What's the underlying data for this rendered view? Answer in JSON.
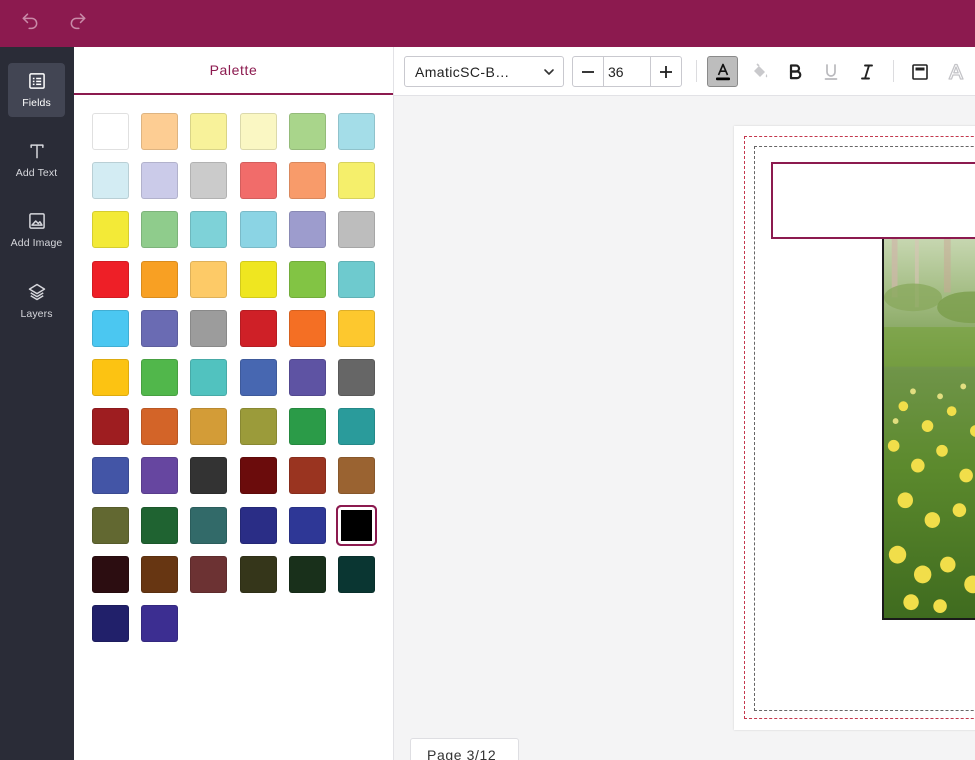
{
  "topbar": {
    "undo_icon": "undo-icon",
    "redo_icon": "redo-icon",
    "background": "#8c1a4f"
  },
  "rail": {
    "items": [
      {
        "label": "Fields",
        "icon": "list-icon",
        "active": true
      },
      {
        "label": "Add Text",
        "icon": "text-t-icon",
        "active": false
      },
      {
        "label": "Add Image",
        "icon": "image-icon",
        "active": false
      },
      {
        "label": "Layers",
        "icon": "layers-icon",
        "active": false
      }
    ]
  },
  "panel": {
    "tab_label": "Palette",
    "swatches": [
      "#ffffff",
      "#fdcd93",
      "#f8f29a",
      "#faf7c3",
      "#a9d58b",
      "#a4dde8",
      "#d3ecf3",
      "#cbcbe9",
      "#cbcbcb",
      "#f16c6a",
      "#f89b6a",
      "#f5ef6b",
      "#f3ea37",
      "#8fcc8c",
      "#7ed2d8",
      "#8bd4e4",
      "#9d9ccd",
      "#bdbdbd",
      "#ee1f27",
      "#f8a023",
      "#fdca67",
      "#efe620",
      "#82c444",
      "#6ecace",
      "#4bc7f1",
      "#6a6bb3",
      "#9c9c9c",
      "#cf2027",
      "#f46f24",
      "#fdc82e",
      "#fcc312",
      "#51b74b",
      "#51c2bf",
      "#4767b1",
      "#5e53a3",
      "#666666",
      "#9e1d20",
      "#d36428",
      "#d39c37",
      "#9b9b3a",
      "#2b9b48",
      "#2a9b9b",
      "#4355a6",
      "#6646a0",
      "#333333",
      "#6b0c0c",
      "#9a3420",
      "#9a6331",
      "#626831",
      "#1f6331",
      "#326a69",
      "#2a2d86",
      "#2e3796",
      "#000000",
      "#2c0d11",
      "#673612",
      "#6c3233",
      "#35361a",
      "#19301b",
      "#0a3632",
      "#21206a",
      "#3c2e91"
    ],
    "selected_swatch": 53
  },
  "toolbar": {
    "font_name": "AmaticSC-B…",
    "font_size": "36",
    "decrease_icon": "minus-icon",
    "increase_icon": "plus-icon",
    "text_color_icon": "text-color-icon",
    "fill_icon": "paint-bucket-icon",
    "bold_icon": "bold-icon",
    "underline_icon": "underline-icon",
    "italic_icon": "italic-icon",
    "align_icon": "text-box-icon",
    "outline_icon": "text-outline-icon"
  },
  "canvas": {
    "page_indicator": "Page 3/12"
  }
}
